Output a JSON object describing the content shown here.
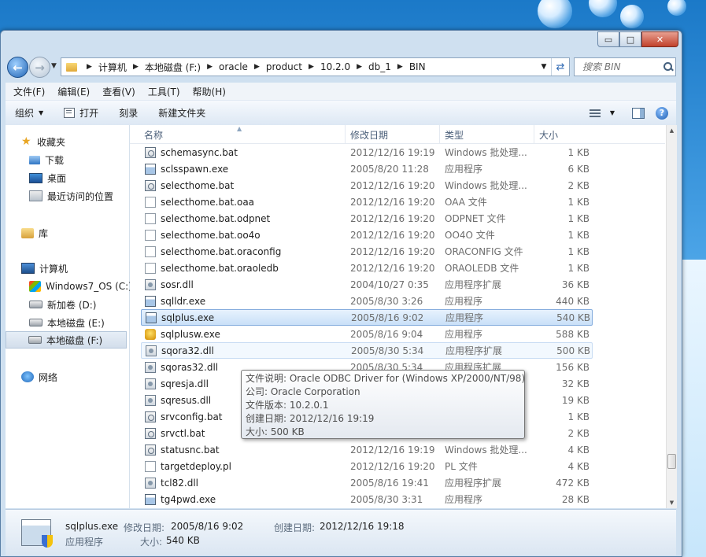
{
  "window": {
    "min": "▭",
    "max": "□",
    "close": "✕"
  },
  "address": {
    "crumbs": [
      "计算机",
      "本地磁盘 (F:)",
      "oracle",
      "product",
      "10.2.0",
      "db_1",
      "BIN"
    ]
  },
  "search": {
    "placeholder": "搜索 BIN"
  },
  "menu": [
    "文件(F)",
    "编辑(E)",
    "查看(V)",
    "工具(T)",
    "帮助(H)"
  ],
  "toolbar": {
    "organize": "组织",
    "open": "打开",
    "burn": "刻录",
    "new_folder": "新建文件夹",
    "help": "?"
  },
  "nav": {
    "favorites": "收藏夹",
    "downloads": "下载",
    "desktop": "桌面",
    "recent": "最近访问的位置",
    "libraries": "库",
    "computer": "计算机",
    "drive_c": "Windows7_OS (C:)",
    "drive_d": "新加卷 (D:)",
    "drive_e": "本地磁盘 (E:)",
    "drive_f": "本地磁盘 (F:)",
    "network": "网络"
  },
  "columns": {
    "name": "名称",
    "date": "修改日期",
    "type": "类型",
    "size": "大小"
  },
  "files": [
    {
      "name": "schemasync.bat",
      "date": "2012/12/16 19:19",
      "type": "Windows 批处理...",
      "size": "1 KB",
      "icon": "bat"
    },
    {
      "name": "sclsspawn.exe",
      "date": "2005/8/20 11:28",
      "type": "应用程序",
      "size": "6 KB",
      "icon": "exe"
    },
    {
      "name": "selecthome.bat",
      "date": "2012/12/16 19:20",
      "type": "Windows 批处理...",
      "size": "2 KB",
      "icon": "bat"
    },
    {
      "name": "selecthome.bat.oaa",
      "date": "2012/12/16 19:20",
      "type": "OAA 文件",
      "size": "1 KB",
      "icon": "file"
    },
    {
      "name": "selecthome.bat.odpnet",
      "date": "2012/12/16 19:20",
      "type": "ODPNET 文件",
      "size": "1 KB",
      "icon": "file"
    },
    {
      "name": "selecthome.bat.oo4o",
      "date": "2012/12/16 19:20",
      "type": "OO4O 文件",
      "size": "1 KB",
      "icon": "file"
    },
    {
      "name": "selecthome.bat.oraconfig",
      "date": "2012/12/16 19:20",
      "type": "ORACONFIG 文件",
      "size": "1 KB",
      "icon": "file"
    },
    {
      "name": "selecthome.bat.oraoledb",
      "date": "2012/12/16 19:20",
      "type": "ORAOLEDB 文件",
      "size": "1 KB",
      "icon": "file"
    },
    {
      "name": "sosr.dll",
      "date": "2004/10/27 0:35",
      "type": "应用程序扩展",
      "size": "36 KB",
      "icon": "dll"
    },
    {
      "name": "sqlldr.exe",
      "date": "2005/8/30 3:26",
      "type": "应用程序",
      "size": "440 KB",
      "icon": "exe"
    },
    {
      "name": "sqlplus.exe",
      "date": "2005/8/16 9:02",
      "type": "应用程序",
      "size": "540 KB",
      "icon": "exe"
    },
    {
      "name": "sqlplusw.exe",
      "date": "2005/8/16 9:04",
      "type": "应用程序",
      "size": "588 KB",
      "icon": "sqlplusw"
    },
    {
      "name": "sqora32.dll",
      "date": "2005/8/30 5:34",
      "type": "应用程序扩展",
      "size": "500 KB",
      "icon": "dll"
    },
    {
      "name": "sqoras32.dll",
      "date": "2005/8/30 5:34",
      "type": "应用程序扩展",
      "size": "156 KB",
      "icon": "dll"
    },
    {
      "name": "sqresja.dll",
      "date": "",
      "type": "",
      "size": "32 KB",
      "icon": "dll"
    },
    {
      "name": "sqresus.dll",
      "date": "",
      "type": "",
      "size": "19 KB",
      "icon": "dll"
    },
    {
      "name": "srvconfig.bat",
      "date": "",
      "type": "",
      "size": "1 KB",
      "icon": "bat"
    },
    {
      "name": "srvctl.bat",
      "date": "",
      "type": "",
      "size": "2 KB",
      "icon": "bat"
    },
    {
      "name": "statusnc.bat",
      "date": "2012/12/16 19:19",
      "type": "Windows 批处理...",
      "size": "4 KB",
      "icon": "bat"
    },
    {
      "name": "targetdeploy.pl",
      "date": "2012/12/16 19:20",
      "type": "PL 文件",
      "size": "4 KB",
      "icon": "file"
    },
    {
      "name": "tcl82.dll",
      "date": "2005/8/16 19:41",
      "type": "应用程序扩展",
      "size": "472 KB",
      "icon": "dll"
    },
    {
      "name": "tg4pwd.exe",
      "date": "2005/8/30 3:31",
      "type": "应用程序",
      "size": "28 KB",
      "icon": "exe"
    }
  ],
  "tooltip": {
    "line1": "文件说明: Oracle ODBC Driver for (Windows XP/2000/NT/98)",
    "line2": "公司: Oracle Corporation",
    "line3": "文件版本: 10.2.0.1",
    "line4": "创建日期: 2012/12/16 19:19",
    "line5": "大小: 500 KB"
  },
  "details": {
    "name": "sqlplus.exe",
    "type": "应用程序",
    "mod_label": "修改日期:",
    "mod_value": "2005/8/16 9:02",
    "create_label": "创建日期:",
    "create_value": "2012/12/16 19:18",
    "size_label": "大小:",
    "size_value": "540 KB"
  }
}
